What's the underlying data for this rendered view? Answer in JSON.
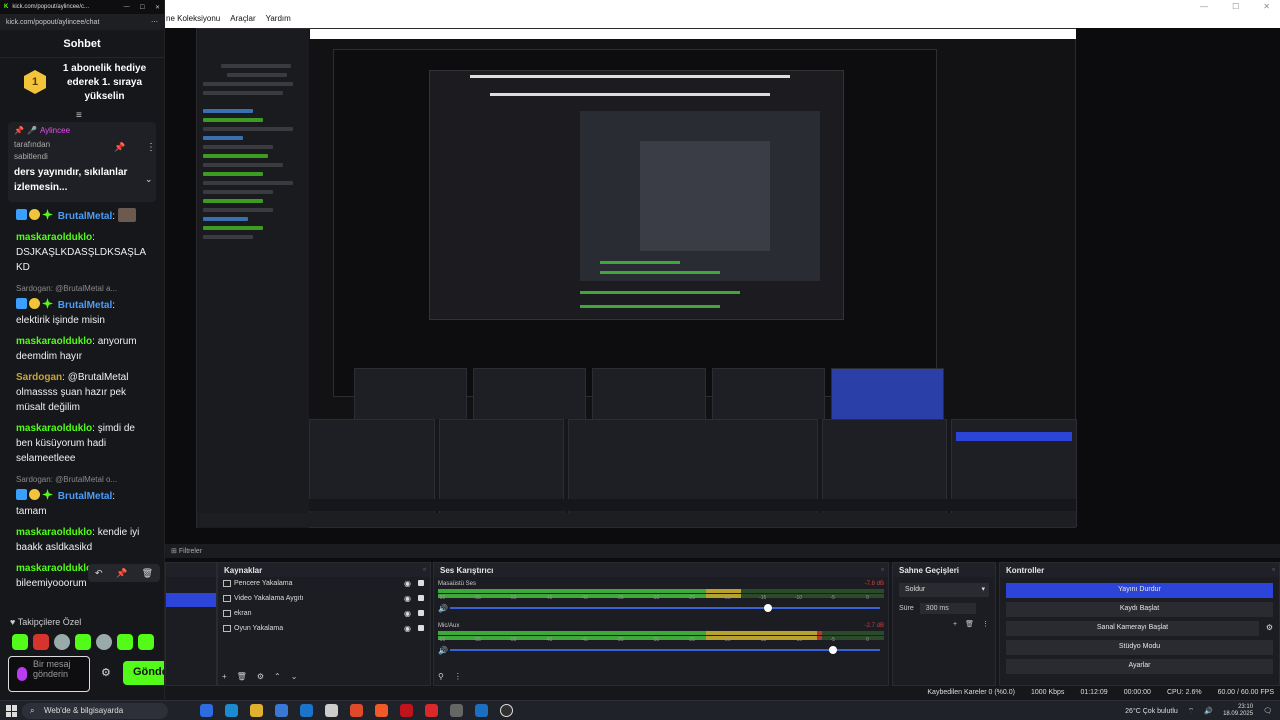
{
  "browser": {
    "tab_title": "kick.com/popout/aylincee/c...",
    "url": "kick.com/popout/aylincee/chat"
  },
  "obs_menu": [
    "ne Koleksiyonu",
    "Araçlar",
    "Yardım"
  ],
  "chat": {
    "header": "Sohbet",
    "gift_banner": "1 abonelik hediye ederek 1. sıraya yükselin",
    "gift_badge_number": "1",
    "pinned": {
      "user": "Aylincee",
      "by_label": "tarafından sabitlendi",
      "message": "ders yayınıdır, sıkılanlar izlemesin..."
    },
    "messages": [
      {
        "reply": "",
        "user": "BrutalMetal",
        "user_color": "blue",
        "text": "",
        "badges": true,
        "avatar": true
      },
      {
        "reply": "",
        "user": "maskaraolduklo",
        "user_color": "green",
        "text": "DSJKAŞLKDASŞLDKSAŞLA KD"
      },
      {
        "reply": "Sardogan: @BrutalMetal a...",
        "user": "BrutalMetal",
        "user_color": "blue",
        "text": "elektirik işinde misin",
        "badges": true
      },
      {
        "reply": "",
        "user": "maskaraolduklo",
        "user_color": "green",
        "text": "anyorum deemdim hayır"
      },
      {
        "reply": "",
        "user": "Sardogan",
        "user_color": "mustard",
        "text": "@BrutalMetal olmassss şuan hazır pek müsalt değilim"
      },
      {
        "reply": "",
        "user": "maskaraolduklo",
        "user_color": "green",
        "text": "şimdi de ben küsüyorum hadi selameetleee"
      },
      {
        "reply": "Sardogan: @BrutalMetal o...",
        "user": "BrutalMetal",
        "user_color": "blue",
        "text": "tamam",
        "badges": true
      },
      {
        "reply": "",
        "user": "maskaraolduklo",
        "user_color": "green",
        "text": "kendie iyi baakk asldkasikd"
      },
      {
        "reply": "",
        "user": "maskaraolduklo",
        "user_color": "green",
        "text": "bileemiyooorum"
      }
    ],
    "emotes_label": "Takipçilere Özel",
    "input_placeholder": "Bir mesaj gönderin",
    "send_label": "Gönder"
  },
  "obs": {
    "filters_label": "Filtreler",
    "sources_title": "Kaynaklar",
    "sources": [
      "Pencere Yakalama",
      "Video Yakalama Aygıtı",
      "ekran",
      "Oyun Yakalama"
    ],
    "mixer_title": "Ses Karıştırıcı",
    "mixer_channels": [
      {
        "name": "Masaüstü Ses",
        "db": "-7.8 dB",
        "level": 0.68,
        "volume": 0.74
      },
      {
        "name": "Mic/Aux",
        "db": "-2.7 dB",
        "level": 0.86,
        "volume": 0.89
      }
    ],
    "meter_ticks": [
      "-60",
      "-55",
      "-50",
      "-45",
      "-40",
      "-35",
      "-30",
      "-25",
      "-20",
      "-15",
      "-10",
      "-5",
      "0"
    ],
    "transitions_title": "Sahne Geçişleri",
    "transition_type": "Soldur",
    "duration_label": "Süre",
    "duration_value": "300 ms",
    "controls_title": "Kontroller",
    "controls": [
      "Yayını Durdur",
      "Kaydı Başlat",
      "Sanal Kamerayı Başlat",
      "Stüdyo Modu",
      "Ayarlar"
    ],
    "status": {
      "dropped": "Kaybedilen Kareler 0 (%0.0)",
      "bitrate": "1000 Kbps",
      "live_time": "01:12:09",
      "rec_time": "00:00:00",
      "cpu": "CPU: 2.6%",
      "fps": "60.00 / 60.00 FPS"
    }
  },
  "taskbar": {
    "search_placeholder": "Web'de & bilgisayarda",
    "weather": "26°C  Çok bulutlu",
    "time": "23:10",
    "date": "18.09.2025"
  }
}
